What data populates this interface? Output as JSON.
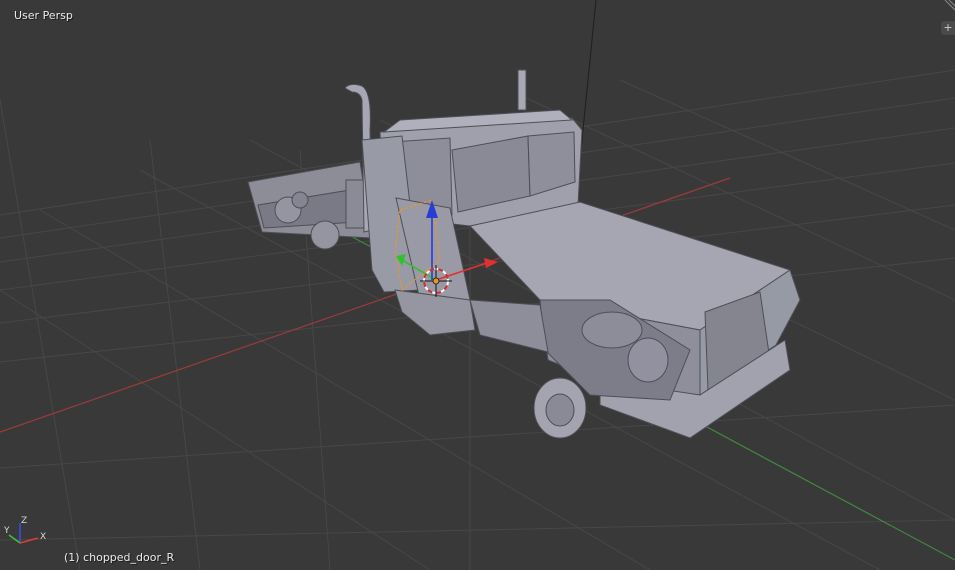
{
  "viewport": {
    "view_label": "User Persp",
    "active_object_label": "(1) chopped_door_R",
    "corner_button_label": "+"
  },
  "mini_axes": {
    "x_label": "X",
    "y_label": "Y",
    "z_label": "Z"
  },
  "colors": {
    "background": "#393939",
    "grid": "#474747",
    "x_axis": "#9c3a3a",
    "y_axis": "#3f8a3f",
    "model": "#9a9aa6",
    "manipulator_x": "#e03030",
    "manipulator_y": "#30c030",
    "manipulator_z": "#2a3cd8",
    "selection_outline": "#e8962a"
  },
  "icons": {
    "corner": "plus-icon",
    "split": "area-split-icon",
    "cursor": "3d-cursor-icon"
  }
}
